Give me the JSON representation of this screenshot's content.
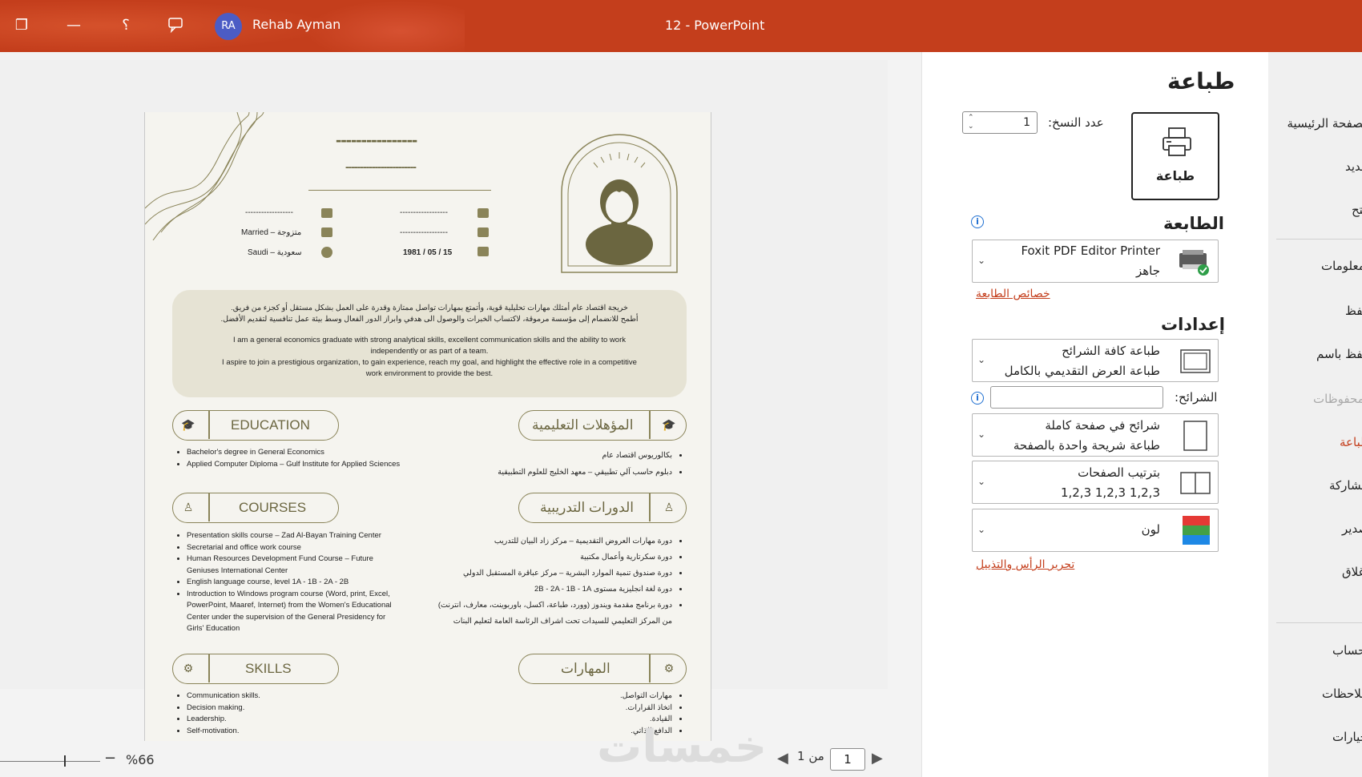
{
  "titlebar": {
    "user_initials": "RA",
    "user_name": "Rehab Ayman",
    "doc_title": "12  -  PowerPoint"
  },
  "page_title": "طباعة",
  "print_panel": {
    "print_button_label": "طباعة",
    "copies_label": "عدد النسخ:",
    "copies_value": "1",
    "printer_heading": "الطابعة",
    "printer_name": "Foxit PDF Editor Printer",
    "printer_status": "جاهز",
    "printer_properties_link": "خصائص الطابعة",
    "settings_heading": "إعدادات",
    "setting_slides_title": "طباعة كافة الشرائح",
    "setting_slides_sub": "طباعة العرض التقديمي بالكامل",
    "slides_label": "الشرائح:",
    "slides_value": "",
    "layout_title": "شرائح في صفحة كاملة",
    "layout_sub": "طباعة شريحة واحدة بالصفحة",
    "collate_title": "بترتيب الصفحات",
    "collate_sub": "1,2,3    1,2,3    1,2,3",
    "color_title": "لون",
    "header_footer_link": "تحرير الرأس والتذييل"
  },
  "rightnav": {
    "items": [
      "الصفحة الرئيسية",
      "جديد",
      "فتح",
      "معلومات",
      "حفظ",
      "حفظ باسم",
      "المحفوظات",
      "طباعة",
      "مشاركة",
      "تصدير",
      "إغلاق",
      "الحساب",
      "ملاحظات",
      "خيارات"
    ]
  },
  "bottom": {
    "zoom": "%66",
    "page_current": "1",
    "page_of": "من 1",
    "watermark": "خمسات"
  },
  "cv": {
    "top_dashes_1": "----------------",
    "top_dashes_2": "------------------------",
    "row1_left": "------------------",
    "row1_right": "------------------",
    "row2_left": "Married – متزوجة",
    "row2_right": "------------------",
    "row3_left": "Saudi – سعودية",
    "row3_right": "1981 / 05 / 15",
    "summary_ar_1": "خريجة اقتصاد عام أمتلك مهارات تحليلية قوية، وأتمتع بمهارات تواصل ممتازة وقدرة على العمل بشكل مستقل أو كجزء من فريق.",
    "summary_ar_2": "أطمح للانضمام إلى مؤسسة مرموقة، لاكتساب الخبرات والوصول الى هدفي وابراز الدور الفعال وسط بيئة عمل تنافسية لتقديم الأفضل.",
    "summary_en_1": "I am a general economics graduate with strong analytical skills, excellent communication skills and the ability to work",
    "summary_en_2": "independently or as part of a team.",
    "summary_en_3": "I aspire to join a prestigious organization, to gain experience, reach my goal, and highlight the effective role in a competitive",
    "summary_en_4": "work environment to provide the best.",
    "edu_en_title": "EDUCATION",
    "edu_ar_title": "المؤهلات التعليمية",
    "edu_en": [
      "Bachelor's degree in General Economics",
      "Applied Computer Diploma – Gulf Institute for Applied Sciences"
    ],
    "edu_ar": [
      "بكالوريوس اقتصاد عام",
      "دبلوم حاسب آلي تطبيقي – معهد الخليج للعلوم التطبيقية"
    ],
    "courses_en_title": "COURSES",
    "courses_ar_title": "الدورات التدريبية",
    "courses_en": [
      "Presentation skills course – Zad Al-Bayan Training Center",
      "Secretarial and office work course",
      "Human Resources Development Fund Course – Future Geniuses International Center",
      "English language course, level 1A - 1B - 2A - 2B",
      "Introduction to Windows program course (Word, print, Excel, PowerPoint, Maaref, Internet) from the Women's Educational Center under the supervision of the General Presidency for Girls' Education"
    ],
    "courses_ar": [
      "دورة مهارات العروض التقديمية – مركز زاد البيان للتدريب",
      "دورة سكرتارية وأعمال مكتبية",
      "دورة صندوق تنمية الموارد البشرية – مركز عباقرة المستقبل الدولي",
      "دورة لغة انجليزية مستوى 2B - 2A - 1B - 1A",
      "دورة برنامج مقدمة ويندوز (وورد، طباعة، اكسل، باوربوينت، معارف، انترنت) من المركز التعليمي للسيدات تحت اشراف الرئاسة العامة لتعليم البنات"
    ],
    "skills_en_title": "SKILLS",
    "skills_ar_title": "المهارات",
    "skills_en": [
      "Communication skills.",
      "Decision making.",
      "Leadership.",
      "Self-motivation."
    ],
    "skills_ar": [
      "مهارات التواصل.",
      "اتخاذ القرارات.",
      "القيادة.",
      "الدافع الذاتي."
    ]
  },
  "colors": {
    "accent": "#c43e1c",
    "cv_olive": "#6b6640",
    "summary_bg": "#e6e3d4"
  }
}
